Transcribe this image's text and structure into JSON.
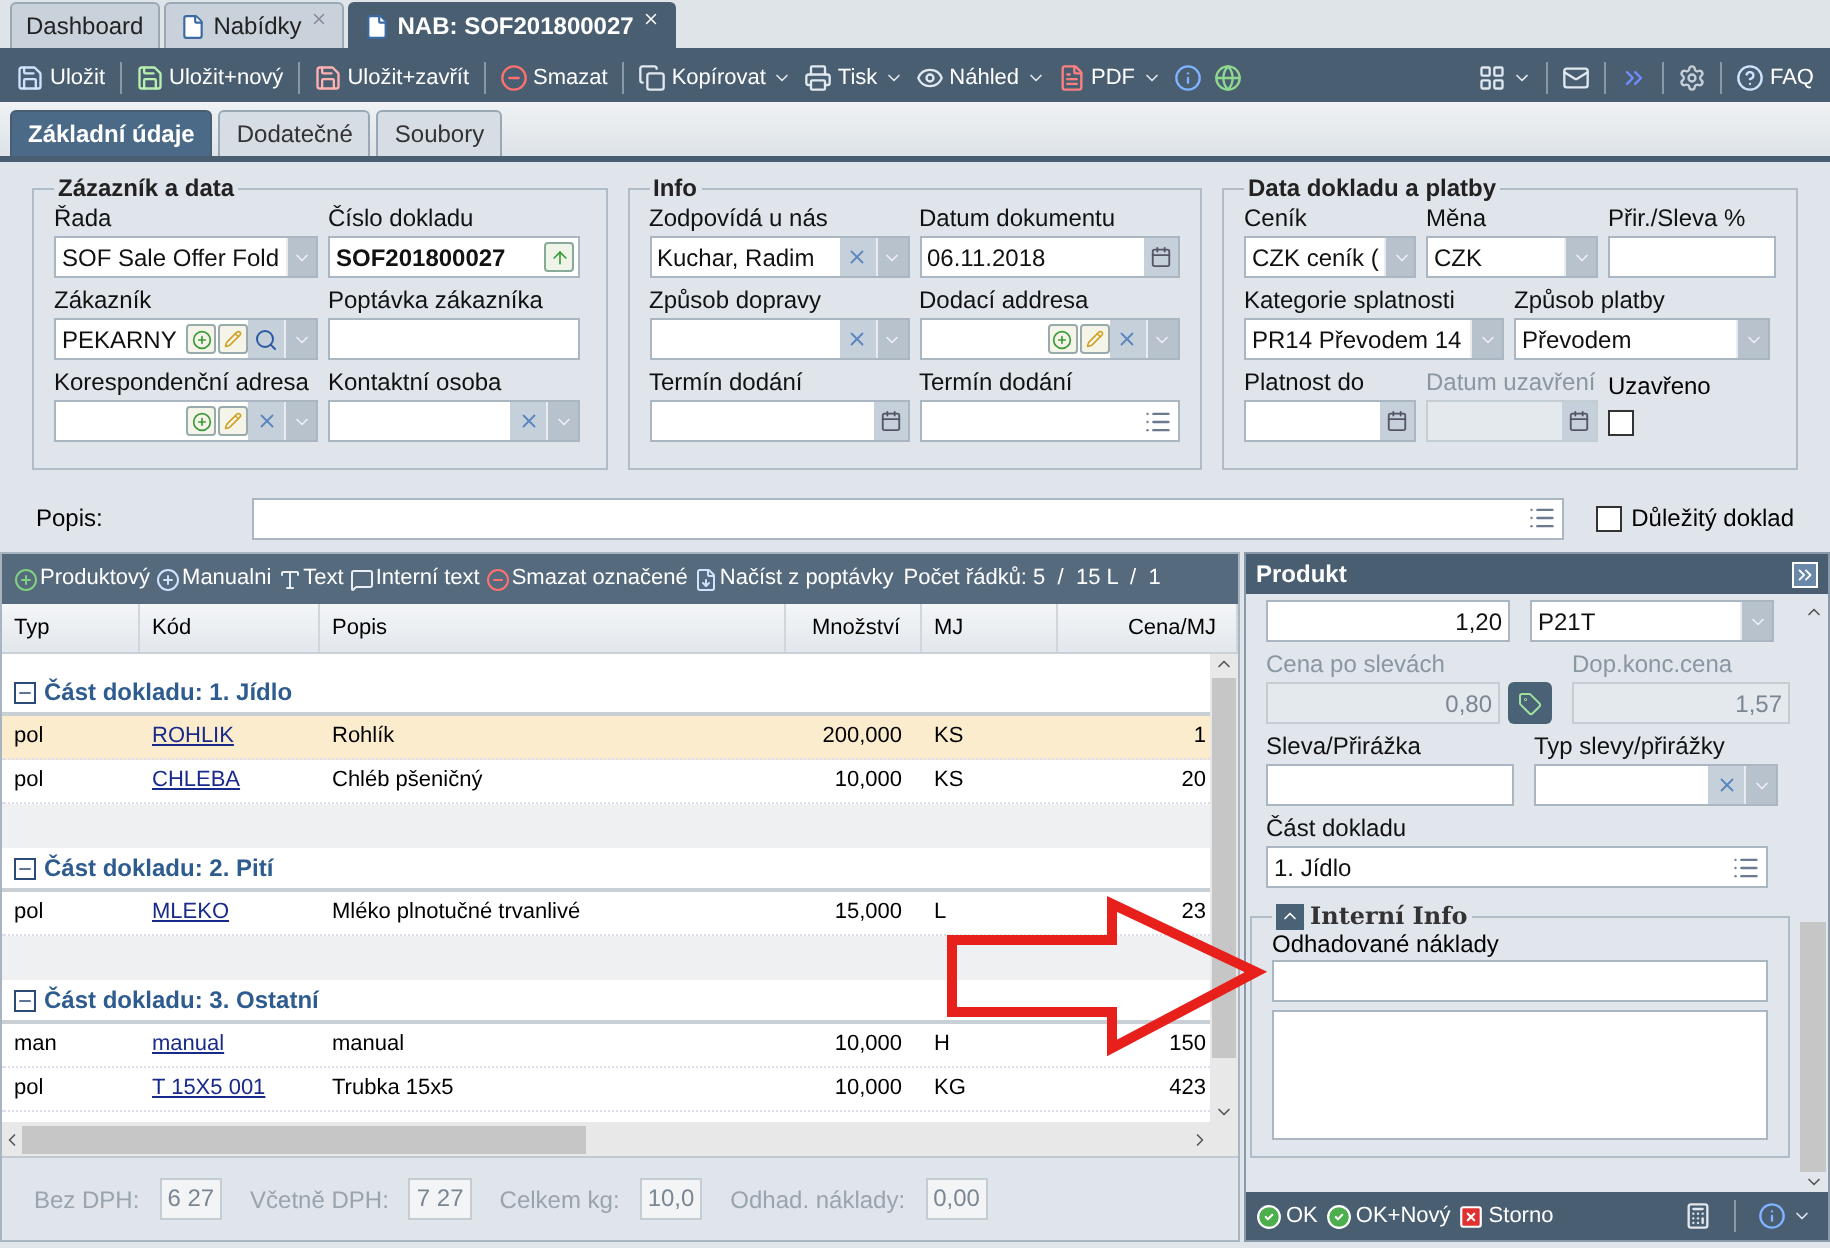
{
  "tabs": [
    {
      "label": "Dashboard",
      "kind": "plain",
      "selected": false
    },
    {
      "label": "Nabídky",
      "kind": "document",
      "selected": false
    },
    {
      "label": "NAB: SOF201800027",
      "kind": "document",
      "selected": true
    }
  ],
  "toolbar": {
    "left": [
      {
        "label": "Uložit",
        "kind": "save",
        "menu": false
      },
      {
        "kind": "separator"
      },
      {
        "label": "Uložit+nový",
        "kind": "save-new",
        "menu": false
      },
      {
        "kind": "separator"
      },
      {
        "label": "Uložit+zavřít",
        "kind": "save-close",
        "menu": false
      },
      {
        "kind": "separator"
      },
      {
        "label": "Smazat",
        "kind": "delete",
        "menu": false
      },
      {
        "kind": "separator"
      },
      {
        "label": "Kopírovat",
        "kind": "copy",
        "menu": true
      },
      {
        "label": "Tisk",
        "kind": "print",
        "menu": true
      },
      {
        "label": "Náhled",
        "kind": "preview",
        "menu": true
      },
      {
        "label": "PDF",
        "kind": "pdf",
        "menu": true
      },
      {
        "kind": "info",
        "menu": false
      },
      {
        "kind": "globe",
        "menu": false
      }
    ],
    "right": [
      {
        "kind": "layout",
        "menu": true
      },
      {
        "kind": "separator"
      },
      {
        "kind": "mail",
        "menu": false
      },
      {
        "kind": "separator"
      },
      {
        "kind": "forward",
        "menu": false
      },
      {
        "kind": "separator"
      },
      {
        "kind": "settings",
        "menu": false
      },
      {
        "kind": "separator"
      },
      {
        "label": "FAQ",
        "kind": "help",
        "menu": false
      }
    ]
  },
  "form_tabs": [
    {
      "label": "Základní údaje",
      "selected": true
    },
    {
      "label": "Dodatečné",
      "selected": false
    },
    {
      "label": "Soubory",
      "selected": false
    }
  ],
  "fieldsets": [
    {
      "title": "Zázazník a data",
      "rows": [
        [
          {
            "label": "Řada",
            "value": "SOF Sale Offer Fold",
            "buttons": [
              {
                "kind": "dropdown"
              }
            ],
            "disabled": false,
            "bold": false
          },
          {
            "label": "Číslo dokladu",
            "value": "SOF201800027",
            "buttons": [
              {
                "kind": "up"
              }
            ],
            "disabled": false,
            "bold": true
          }
        ],
        [
          {
            "label": "Zákazník",
            "value": "PEKARNY",
            "buttons": [
              {
                "kind": "add"
              },
              {
                "kind": "edit"
              },
              {
                "kind": "search"
              },
              {
                "kind": "dropdown"
              }
            ],
            "disabled": false,
            "bold": false
          },
          {
            "label": "Poptávka zákazníka",
            "disabled": false
          }
        ],
        [
          {
            "label": "Korespondenční adresa",
            "buttons": [
              {
                "kind": "add"
              },
              {
                "kind": "edit"
              },
              {
                "kind": "clear"
              },
              {
                "kind": "dropdown"
              }
            ],
            "disabled": false
          },
          {
            "label": "Kontaktní osoba",
            "buttons": [
              {
                "kind": "clear"
              },
              {
                "kind": "dropdown"
              }
            ],
            "disabled": false
          }
        ]
      ]
    },
    {
      "title": "Info",
      "rows": [
        [
          {
            "label": "Zodpovídá u nás",
            "value": "Kuchar, Radim",
            "buttons": [
              {
                "kind": "clear"
              },
              {
                "kind": "dropdown"
              }
            ],
            "disabled": false,
            "bold": false
          },
          {
            "label": "Datum dokumentu",
            "value": "06.11.2018",
            "buttons": [
              {
                "kind": "calendar"
              }
            ],
            "disabled": false,
            "bold": false
          }
        ],
        [
          {
            "label": "Způsob dopravy",
            "buttons": [
              {
                "kind": "clear"
              },
              {
                "kind": "dropdown"
              }
            ],
            "disabled": false
          },
          {
            "label": "Dodací addresa",
            "buttons": [
              {
                "kind": "add"
              },
              {
                "kind": "edit"
              },
              {
                "kind": "clear"
              },
              {
                "kind": "dropdown"
              }
            ],
            "disabled": false
          }
        ],
        [
          {
            "label": "Termín dodání",
            "buttons": [
              {
                "kind": "calendar"
              }
            ],
            "disabled": false
          },
          {
            "label": "Termín dodání",
            "buttons": [
              {
                "kind": "list"
              }
            ],
            "disabled": false
          }
        ]
      ]
    },
    {
      "title": "Data dokladu a platby",
      "rows": [
        [
          {
            "label": "Ceník",
            "value": "CZK ceník (",
            "buttons": [
              {
                "kind": "dropdown"
              }
            ],
            "disabled": false,
            "bold": false
          },
          {
            "label": "Měna",
            "value": "CZK",
            "buttons": [
              {
                "kind": "dropdown"
              }
            ],
            "disabled": false,
            "bold": false
          },
          {
            "label": "Přir./Sleva %",
            "disabled": false
          }
        ],
        [
          {
            "label": "Kategorie splatnosti",
            "value": "PR14 Převodem 14",
            "buttons": [
              {
                "kind": "dropdown"
              }
            ],
            "disabled": false,
            "bold": false
          },
          {
            "label": "Způsob platby",
            "value": "Převodem",
            "buttons": [
              {
                "kind": "dropdown"
              }
            ],
            "disabled": false,
            "bold": false
          }
        ],
        [
          {
            "label": "Platnost do",
            "buttons": [
              {
                "kind": "calendar"
              }
            ],
            "disabled": false
          },
          {
            "label": "Datum uzavření",
            "buttons": [
              {
                "kind": "calendar"
              }
            ],
            "disabled": true
          },
          {
            "label": "Uzavřeno",
            "kind": "checkbox",
            "checked": false
          }
        ]
      ]
    }
  ],
  "description": {
    "label": "Popis:",
    "buttons": [
      {
        "kind": "list"
      }
    ]
  },
  "important": {
    "label": "Důležitý doklad",
    "checked": false
  },
  "grid": {
    "toolbar": [
      {
        "label": "Produktový",
        "kind": "add"
      },
      {
        "label": "Manualni",
        "kind": "manual"
      },
      {
        "label": "Text",
        "kind": "text"
      },
      {
        "label": "Interní text",
        "kind": "internal"
      },
      {
        "label": "Smazat označené",
        "kind": "delete"
      },
      {
        "label": "Načíst z poptávky",
        "kind": "import"
      }
    ],
    "row_count": "Počet řádků: 5  /  15 L  /  1",
    "columns": [
      "Typ",
      "Kód",
      "Popis",
      "Množství",
      "MJ",
      "Cena/MJ"
    ],
    "groups": [
      {
        "title": "Část dokladu: 1. Jídlo",
        "expanded": true,
        "rows": [
          {
            "cells": [
              "pol",
              "ROHLIK",
              "Rohlík",
              "200,000",
              "KS",
              "1"
            ],
            "selected": true
          },
          {
            "cells": [
              "pol",
              "CHLEBA",
              "Chléb pšeničný",
              "10,000",
              "KS",
              "20"
            ],
            "selected": false
          }
        ]
      },
      {
        "title": "Část dokladu: 2. Pití",
        "expanded": true,
        "rows": [
          {
            "cells": [
              "pol",
              "MLEKO",
              "Mléko plnotučné trvanlivé",
              "15,000",
              "L",
              "23"
            ],
            "selected": false
          }
        ]
      },
      {
        "title": "Část dokladu: 3. Ostatní",
        "expanded": true,
        "rows": [
          {
            "cells": [
              "man",
              "manual",
              "manual",
              "10,000",
              "H",
              "150"
            ],
            "selected": false
          },
          {
            "cells": [
              "pol",
              "T 15X5 001",
              "Trubka 15x5",
              "10,000",
              "KG",
              "423"
            ],
            "selected": false
          }
        ]
      }
    ],
    "totals": [
      {
        "label": "Bez DPH:",
        "value": "6 27"
      },
      {
        "label": "Včetně DPH:",
        "value": "7 27"
      },
      {
        "label": "Celkem kg:",
        "value": "10,0"
      },
      {
        "label": "Odhad. náklady:",
        "value": "0,00"
      }
    ]
  },
  "product": {
    "title": "Produkt",
    "rows": [
      [
        {
          "value": "1,20",
          "disabled": false,
          "numeric": true
        },
        {
          "value": "P21T",
          "buttons": [
            {
              "kind": "dropdown"
            }
          ],
          "disabled": false,
          "numeric": false
        }
      ],
      [
        {
          "label": "Cena po slevách",
          "value": "0,80",
          "buttons": [
            {
              "kind": "price"
            }
          ],
          "disabled": true,
          "numeric": true
        },
        {
          "label": "Dop.konc.cena",
          "value": "1,57",
          "disabled": true,
          "numeric": true
        }
      ],
      [
        {
          "label": "Sleva/Přirážka",
          "disabled": false
        },
        {
          "label": "Typ slevy/přirážky",
          "buttons": [
            {
              "kind": "clear"
            },
            {
              "kind": "dropdown"
            }
          ],
          "disabled": false
        }
      ],
      [
        {
          "label": "Část dokladu",
          "value": "1. Jídlo",
          "buttons": [
            {
              "kind": "list"
            }
          ],
          "disabled": false,
          "numeric": false
        }
      ]
    ],
    "internal": {
      "title": "Interní Info",
      "expanded": true,
      "field_label": "Odhadované náklady"
    },
    "footer": [
      {
        "label": "OK",
        "kind": "ok"
      },
      {
        "label": "OK+Nový",
        "kind": "ok"
      },
      {
        "label": "Storno",
        "kind": "cancel"
      }
    ],
    "footer_right": [
      {
        "kind": "calculator",
        "menu": false
      },
      {
        "kind": "separator"
      },
      {
        "kind": "info",
        "menu": true
      }
    ]
  }
}
